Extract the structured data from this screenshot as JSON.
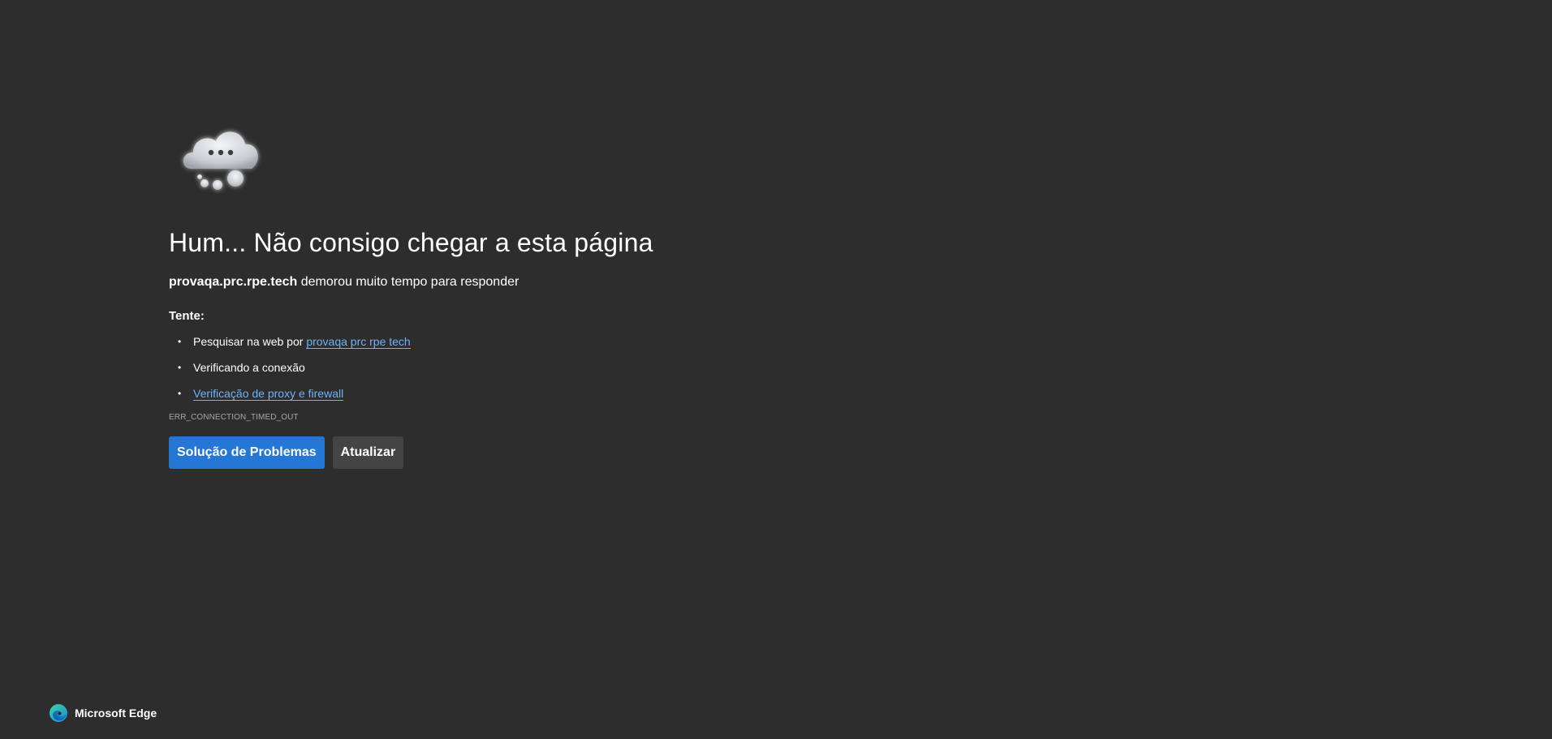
{
  "error_page": {
    "title": "Hum... Não consigo chegar a esta página",
    "host": "provaqa.prc.rpe.tech",
    "message": " demorou muito tempo para responder",
    "try_label": "Tente:",
    "suggestions": {
      "search_prefix": "Pesquisar na web por ",
      "search_link": "provaqa prc rpe tech",
      "checking_connection": "Verificando a conexão",
      "proxy_firewall_link": "Verificação de proxy e firewall"
    },
    "error_code": "ERR_CONNECTION_TIMED_OUT",
    "buttons": {
      "troubleshoot": "Solução de Problemas",
      "refresh": "Atualizar"
    }
  },
  "footer": {
    "brand": "Microsoft Edge"
  },
  "icons": {
    "cloud": "cloud-ellipsis-icon",
    "edge_logo": "edge-logo-icon"
  },
  "colors": {
    "background": "#2d2d2d",
    "link": "#6fb2f5",
    "primary_button": "#2577d6",
    "secondary_button": "#444444",
    "error_code": "#a6a6a6"
  }
}
